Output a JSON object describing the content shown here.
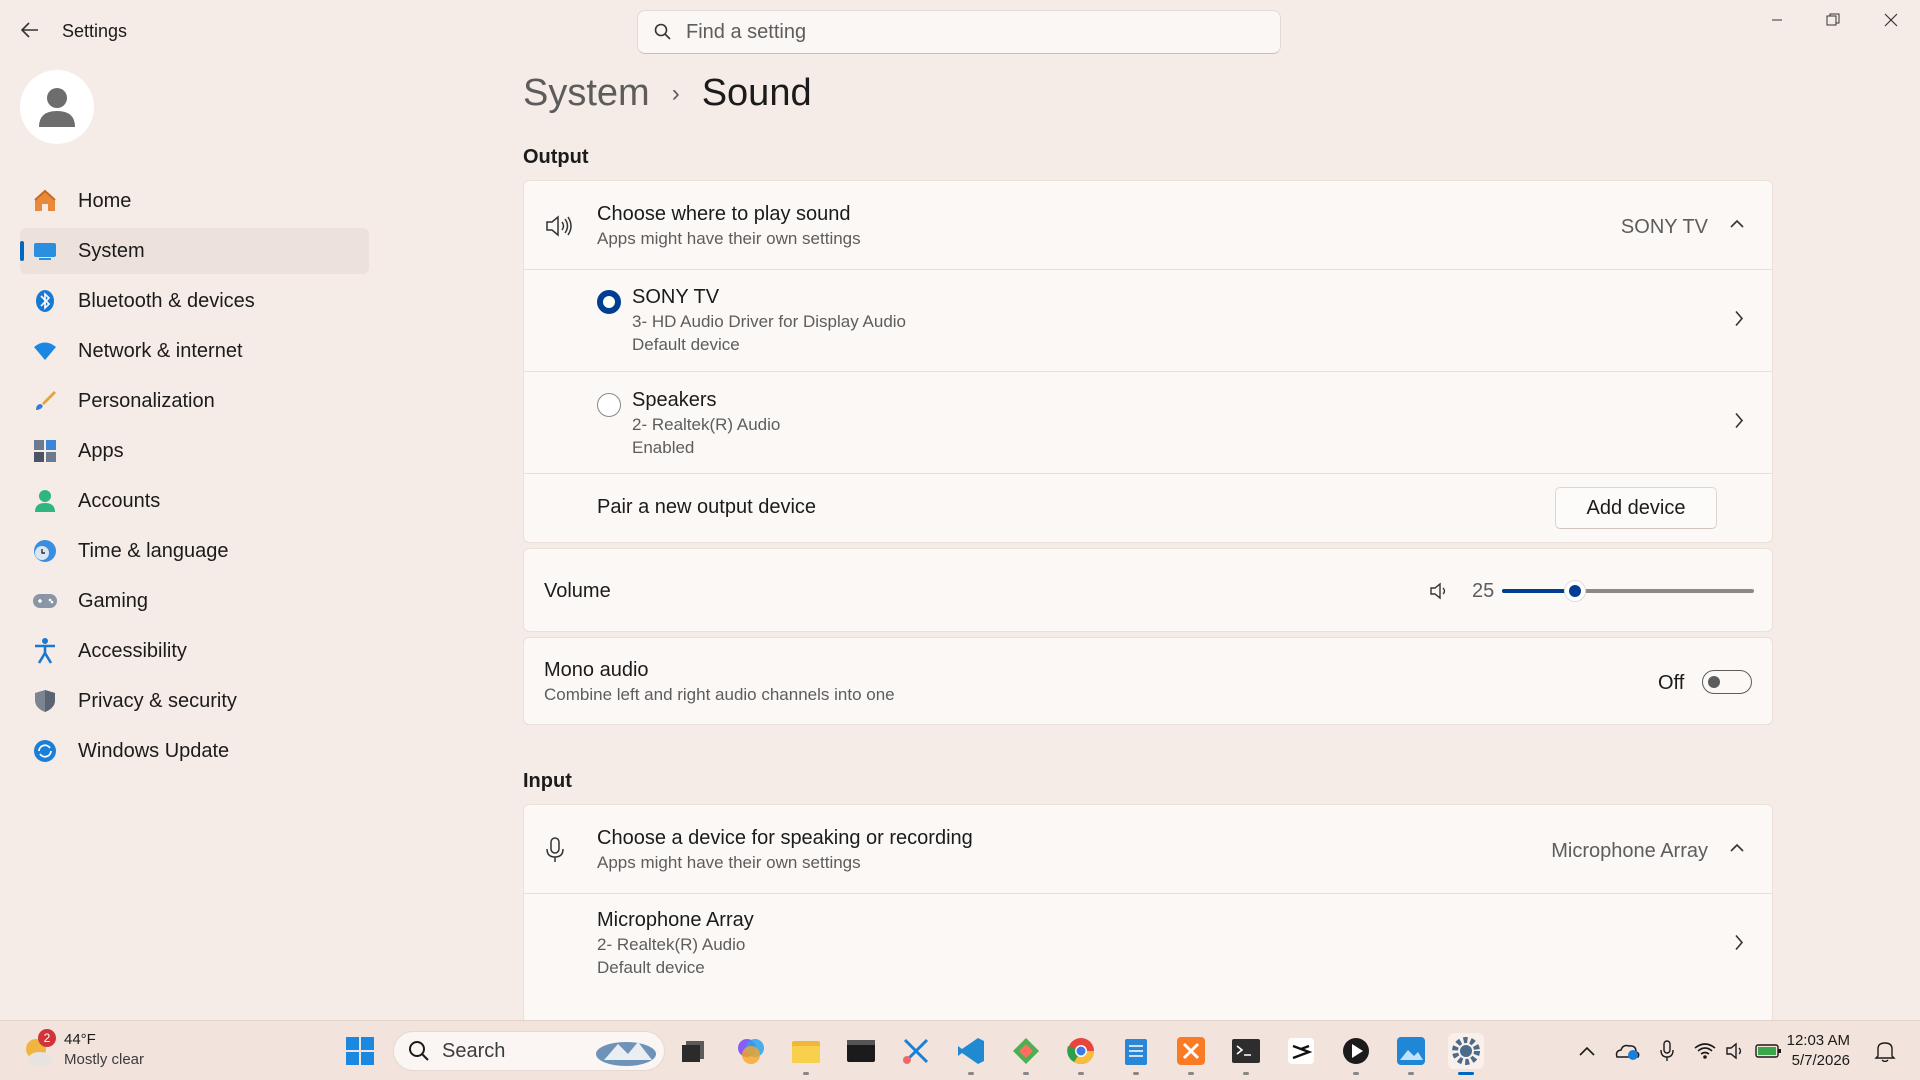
{
  "window": {
    "title": "Settings",
    "search_placeholder": "Find a setting"
  },
  "sidebar": {
    "items": [
      {
        "label": "Home",
        "icon": "home-icon"
      },
      {
        "label": "System",
        "icon": "system-icon",
        "active": true
      },
      {
        "label": "Bluetooth & devices",
        "icon": "bluetooth-icon"
      },
      {
        "label": "Network & internet",
        "icon": "wifi-icon"
      },
      {
        "label": "Personalization",
        "icon": "brush-icon"
      },
      {
        "label": "Apps",
        "icon": "apps-icon"
      },
      {
        "label": "Accounts",
        "icon": "accounts-icon"
      },
      {
        "label": "Time & language",
        "icon": "clock-globe-icon"
      },
      {
        "label": "Gaming",
        "icon": "gamepad-icon"
      },
      {
        "label": "Accessibility",
        "icon": "accessibility-icon"
      },
      {
        "label": "Privacy & security",
        "icon": "shield-icon"
      },
      {
        "label": "Windows Update",
        "icon": "update-icon"
      }
    ]
  },
  "breadcrumb": {
    "parent": "System",
    "separator": "›",
    "current": "Sound"
  },
  "output": {
    "section_title": "Output",
    "choose_title": "Choose where to play sound",
    "choose_sub": "Apps might have their own settings",
    "selected": "SONY TV",
    "devices": [
      {
        "name": "SONY TV",
        "line1": "3- HD Audio Driver for Display Audio",
        "line2": "Default device",
        "selected": true
      },
      {
        "name": "Speakers",
        "line1": "2- Realtek(R) Audio",
        "line2": "Enabled",
        "selected": false
      }
    ],
    "pair_label": "Pair a new output device",
    "add_button": "Add device"
  },
  "volume": {
    "label": "Volume",
    "value": "25",
    "level": 25
  },
  "mono": {
    "title": "Mono audio",
    "sub": "Combine left and right audio channels into one",
    "state": "Off"
  },
  "input": {
    "section_title": "Input",
    "choose_title": "Choose a device for speaking or recording",
    "choose_sub": "Apps might have their own settings",
    "selected": "Microphone Array",
    "device": {
      "name": "Microphone Array",
      "line1": "2- Realtek(R) Audio",
      "line2": "Default device"
    }
  },
  "taskbar": {
    "weather_temp": "44°F",
    "weather_desc": "Mostly clear",
    "weather_badge": "2",
    "search_label": "Search",
    "time": "12:03 AM",
    "date": "5/7/2026"
  },
  "colors": {
    "accent": "#0067c0",
    "background": "#f6ece7",
    "card": "#fbf8f6"
  }
}
